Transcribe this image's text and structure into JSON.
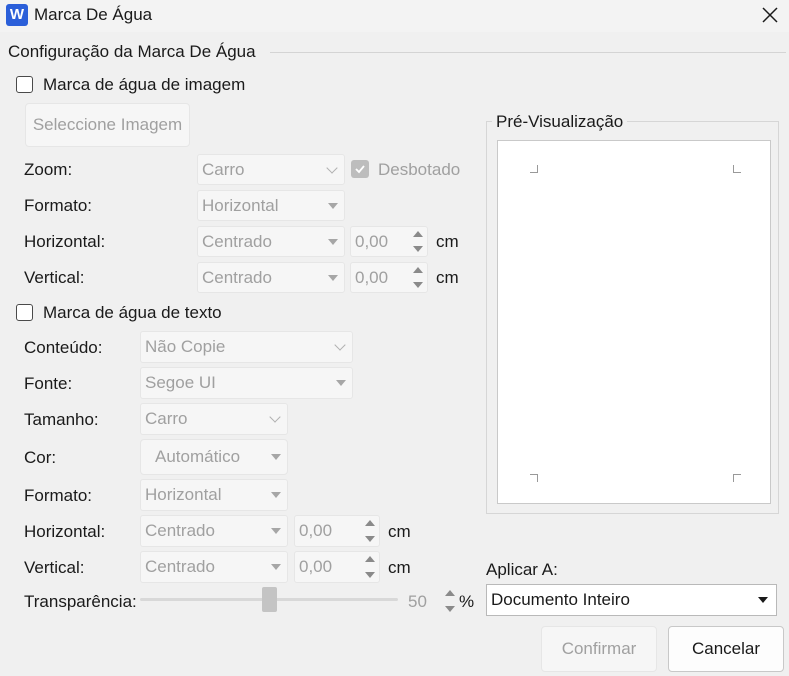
{
  "window": {
    "title": "Marca De Água",
    "app_icon_letter": "W"
  },
  "group_title": "Configuração da Marca De Água",
  "image_watermark": {
    "checkbox_label": "Marca de água de imagem",
    "checked": false,
    "select_image_button": "Seleccione Imagem",
    "zoom_label": "Zoom:",
    "zoom_value": "Carro",
    "washout_label": "Desbotado",
    "washout_checked": true,
    "format_label": "Formato:",
    "format_value": "Horizontal",
    "horizontal_label": "Horizontal:",
    "horizontal_value": "Centrado",
    "horizontal_offset": "0,00",
    "horizontal_unit": "cm",
    "vertical_label": "Vertical:",
    "vertical_value": "Centrado",
    "vertical_offset": "0,00",
    "vertical_unit": "cm"
  },
  "text_watermark": {
    "checkbox_label": "Marca de água de texto",
    "checked": false,
    "content_label": "Conteúdo:",
    "content_value": "Não Copie",
    "font_label": "Fonte:",
    "font_value": "Segoe UI",
    "size_label": "Tamanho:",
    "size_value": "Carro",
    "color_label": "Cor:",
    "color_value": "Automático",
    "format_label": "Formato:",
    "format_value": "Horizontal",
    "horizontal_label": "Horizontal:",
    "horizontal_value": "Centrado",
    "horizontal_offset": "0,00",
    "horizontal_unit": "cm",
    "vertical_label": "Vertical:",
    "vertical_value": "Centrado",
    "vertical_offset": "0,00",
    "vertical_unit": "cm",
    "transparency_label": "Transparência:",
    "transparency_value": "50",
    "transparency_unit": "%"
  },
  "preview": {
    "title": "Pré-Visualização"
  },
  "apply": {
    "label": "Aplicar A:",
    "value": "Documento Inteiro"
  },
  "buttons": {
    "confirm": "Confirmar",
    "cancel": "Cancelar"
  },
  "colors": {
    "accent": "#2b5fd9",
    "disabled_text": "#a0a0a0"
  },
  "icons": [
    "app-word-icon",
    "close-icon",
    "checkmark-icon",
    "dropdown-caret-icon",
    "chevron-down-icon",
    "spin-up-icon",
    "spin-down-icon"
  ]
}
